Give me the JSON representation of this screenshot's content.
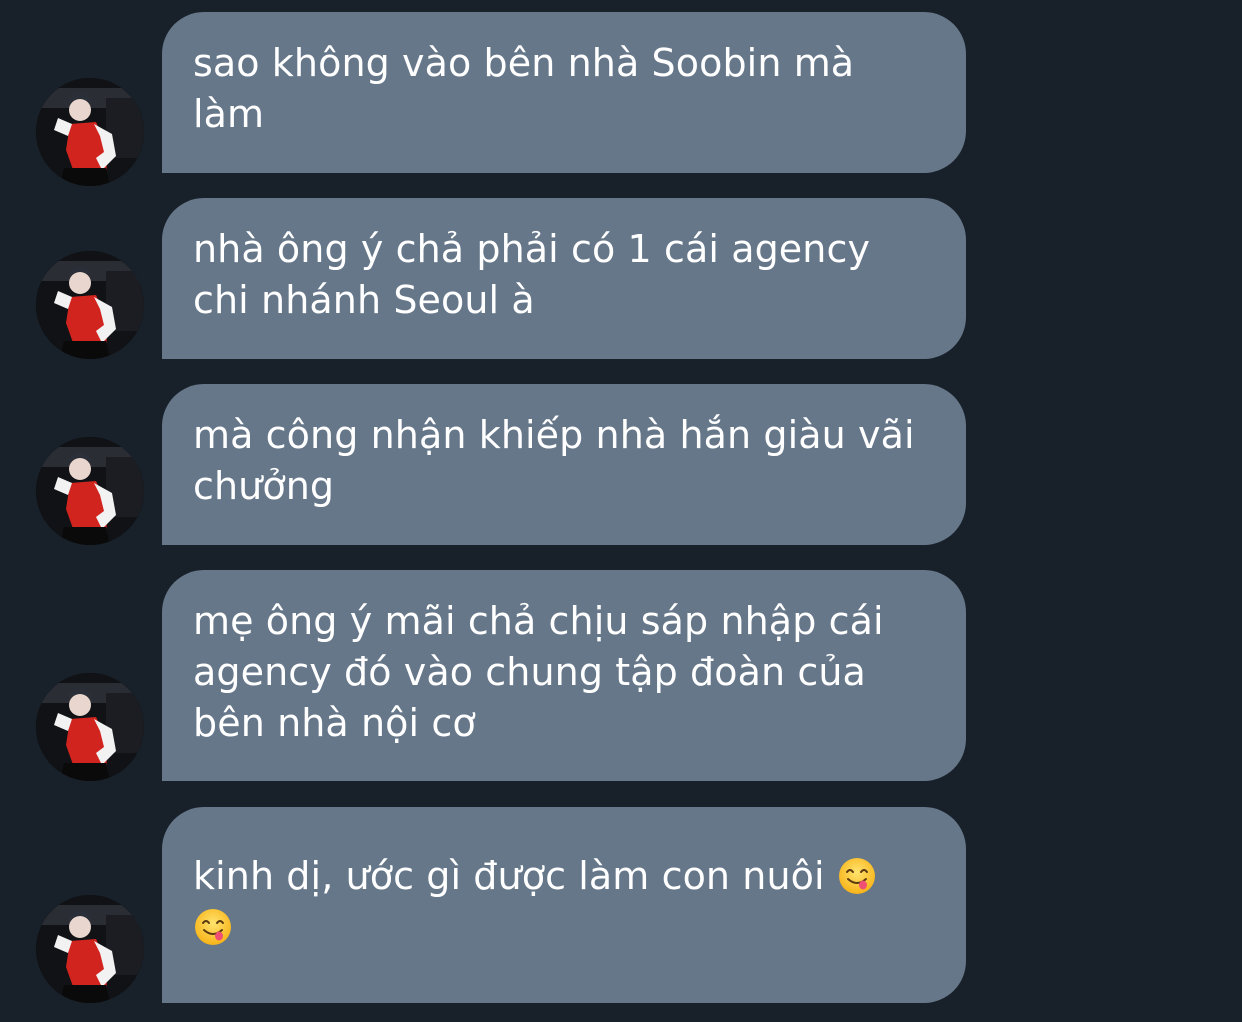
{
  "chat": {
    "messages": [
      {
        "text": "sao không vào bên nhà Soobin mà làm"
      },
      {
        "text": "nhà ông ý chả phải có 1 cái agency chi nhánh Seoul à"
      },
      {
        "text": "mà công nhận khiếp nhà hắn giàu vãi chưởng"
      },
      {
        "text": "mẹ ông ý mãi chả chịu sáp nhập cái agency đó vào chung tập đoàn của bên nhà nội cơ"
      },
      {
        "text_before_emoji": "kinh dị, ước gì được làm con nuôi ",
        "emoji_1": "face-savoring-food-emoji",
        "emoji_2": "face-savoring-food-emoji"
      }
    ],
    "avatar_icon": "user-avatar-photo",
    "colors": {
      "background": "#182029",
      "bubble": "#66778a",
      "text": "#ffffff"
    }
  }
}
